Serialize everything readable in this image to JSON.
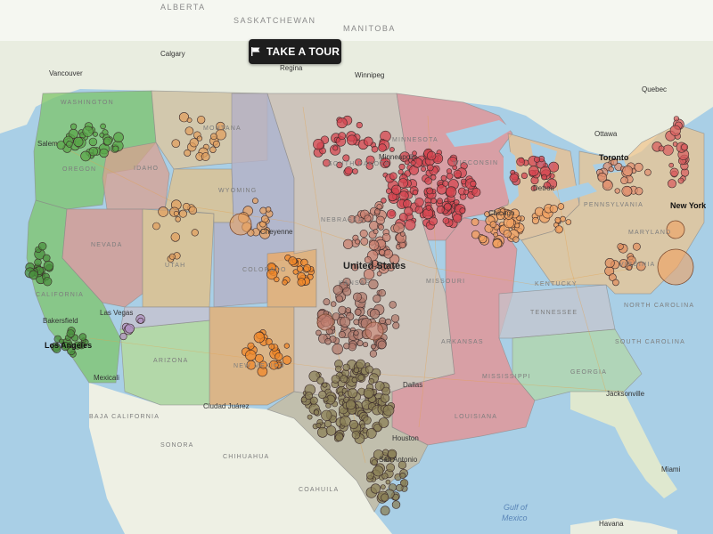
{
  "toolbar": {
    "tour_label": "TAKE A TOUR",
    "tour_icon": "flag-icon"
  },
  "colors": {
    "ocean": "#a9cfe6",
    "land_ca": "#eef0e4",
    "land_mx": "#eef0e4",
    "region_green": "#7dc46a",
    "region_salmon": "#d99a84",
    "region_tan": "#d9c28a",
    "region_orange": "#e8a860",
    "region_beige": "#d9c2a6",
    "region_red": "#e28a8a",
    "region_grey": "#bdbcc8",
    "region_purple_grey": "#b6b4c8",
    "region_peach": "#f0c38a",
    "region_lightgreen": "#b8d8a0",
    "region_lavender": "#c9c0d6"
  },
  "labels": {
    "countries": [
      "ALBERTA",
      "SASKATCHEWAN",
      "MANITOBA"
    ],
    "states_upper": [
      "MONTANA",
      "WYOMING",
      "IDAHO",
      "NEVADA",
      "UTAH",
      "COLORADO",
      "ARIZONA",
      "NEW MEXICO",
      "SOUTH DAKOTA",
      "NEBRASKA",
      "KANSAS",
      "MINNESOTA",
      "WISCONSIN",
      "MISSOURI",
      "ARKANSAS",
      "LOUISIANA",
      "MISSISSIPPI",
      "TENNESSEE",
      "KENTUCKY",
      "VIRGINIA",
      "NORTH CAROLINA",
      "SOUTH CAROLINA",
      "GEORGIA",
      "PENNSYLVANIA",
      "MARYLAND",
      "CALIFORNIA",
      "WASHINGTON",
      "OREGON",
      "CHIHUAHUA",
      "SONORA",
      "COAHUILA",
      "BAJA CALIFORNIA"
    ],
    "cities": [
      "Vancouver",
      "Calgary",
      "Regina",
      "Winnipeg",
      "Salem",
      "Bakersfield",
      "Las Vegas",
      "Los Angeles",
      "Mexicali",
      "Cheyenne",
      "Minneapolis",
      "Detroit",
      "Chicago",
      "Toronto",
      "Ottawa",
      "Quebec",
      "New York",
      "Dallas",
      "Houston",
      "San Antonio",
      "Ciudad Juárez",
      "Jacksonville",
      "Miami",
      "Havana"
    ],
    "country_center": "United States",
    "water": [
      "Gulf of",
      "Mexico"
    ]
  }
}
